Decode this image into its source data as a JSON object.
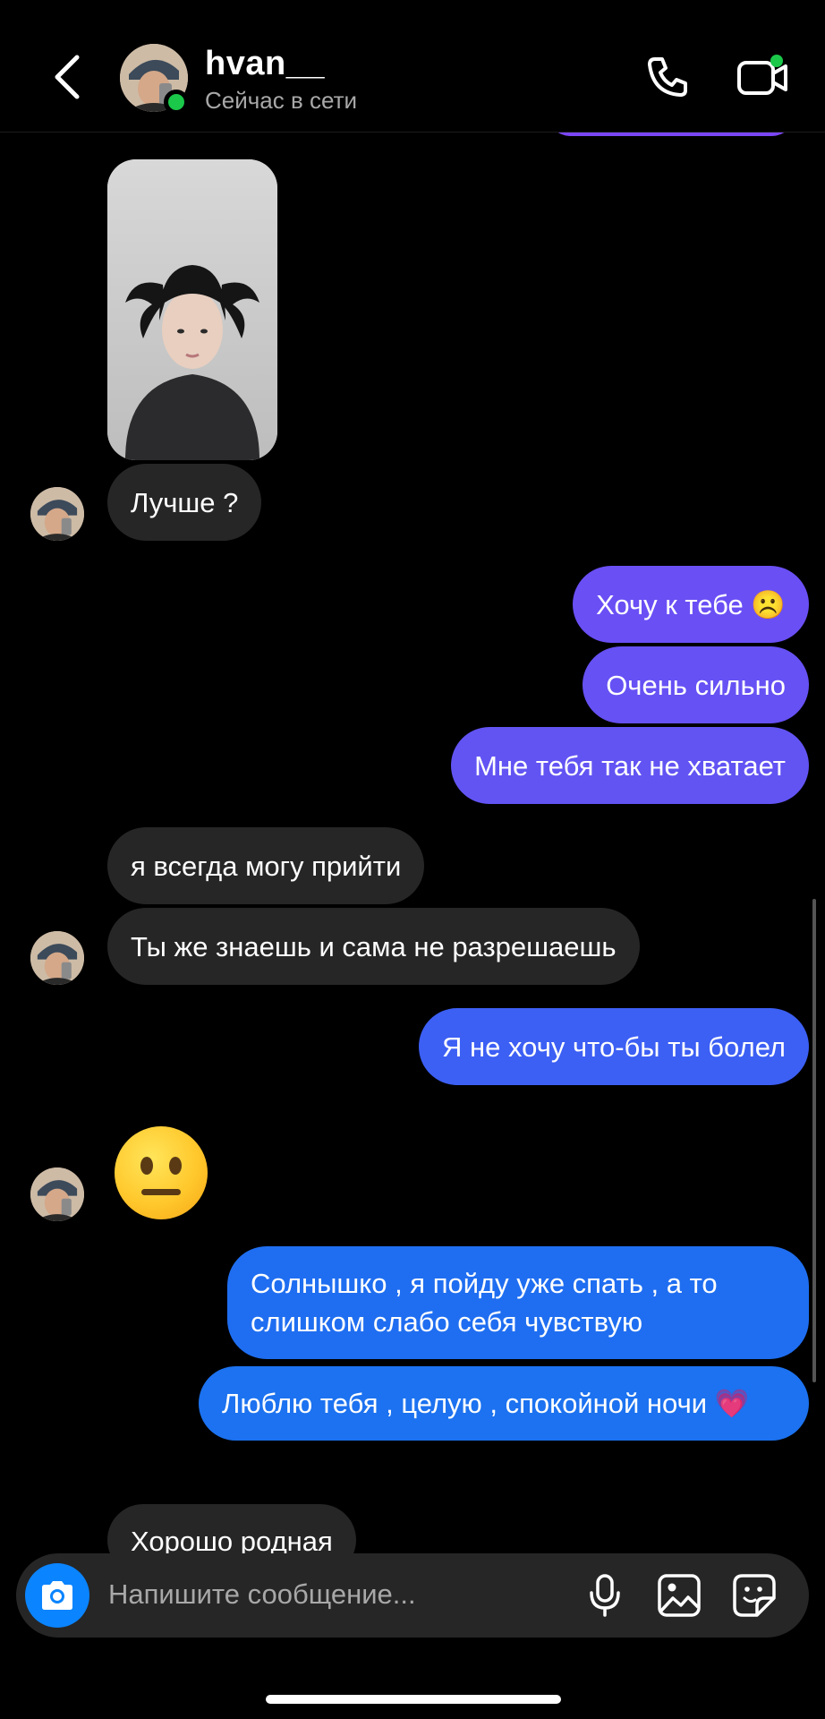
{
  "header": {
    "username": "hvan__",
    "status": "Сейчас в сети"
  },
  "messages": {
    "m1": "Лучше ?",
    "m2": "Хочу к тебе ☹️",
    "m3": "Очень сильно",
    "m4": "Мне тебя так не хватает",
    "m5": "я всегда  могу прийти",
    "m6": "Ты же знаешь и сама не разрешаешь",
    "m7": "Я не хочу что-бы ты болел",
    "m8": "Солнышко , я пойду уже спать , а то слишком слабо себя чувствую",
    "m9": "Люблю тебя , целую , спокойной ночи 💗",
    "m10": "Хорошо родная"
  },
  "composer": {
    "placeholder": "Напишите сообщение..."
  },
  "colors": {
    "outgoing_purple": "#6a4ff5",
    "outgoing_blue": "#1d6ff0",
    "incoming": "#262626",
    "online": "#1bc84a",
    "camera_button": "#0a84ff"
  }
}
